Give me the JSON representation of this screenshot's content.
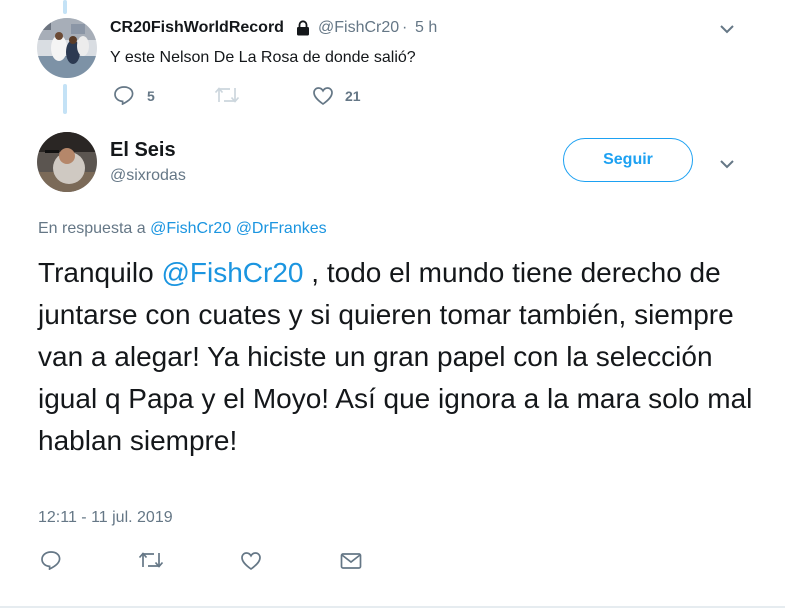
{
  "first_tweet": {
    "display_name": "CR20FishWorldRecord",
    "handle": "@FishCr20",
    "separator": "·",
    "time_ago": "5 h",
    "text": "Y este Nelson De La Rosa de donde salió?",
    "reply_count": "5",
    "like_count": "21",
    "icons": [
      "lock-icon",
      "chevron-down-icon",
      "reply-icon",
      "retweet-icon",
      "like-icon"
    ]
  },
  "main_tweet": {
    "display_name": "El Seis",
    "handle": "@sixrodas",
    "follow_label": "Seguir",
    "reply_to_prefix": "En respuesta a",
    "reply_to_user1": "@FishCr20",
    "reply_to_user2": "@DrFrankes",
    "text_before": "Tranquilo ",
    "mention": "@FishCr20",
    "text_after": " , todo el mundo tiene derecho de juntarse con cuates y si quieren tomar también, siempre van a alegar! Ya hiciste un gran papel con la selección igual q Papa y el Moyo! Así que ignora a la mara solo mal hablan siempre!",
    "timestamp": "12:11 - 11 jul. 2019",
    "icons": [
      "chevron-down-icon",
      "reply-icon",
      "retweet-icon",
      "like-icon",
      "dm-icon"
    ]
  },
  "colors": {
    "link": "#1b95e0",
    "muted": "#657786",
    "thread_line": "#c4e2f6",
    "follow_blue": "#1da1f2"
  }
}
